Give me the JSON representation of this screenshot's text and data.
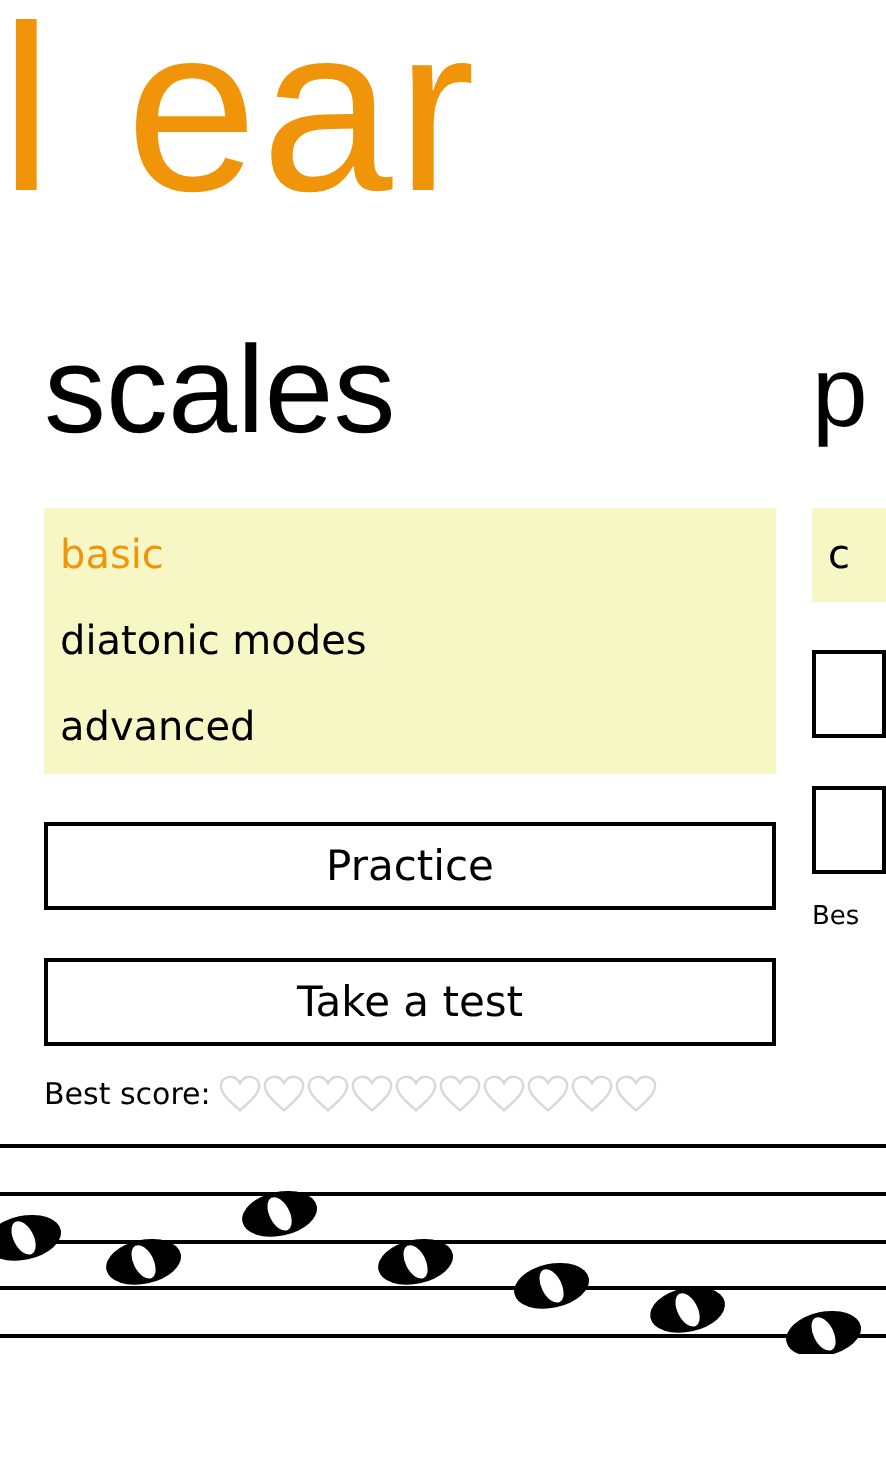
{
  "title": "l ear",
  "sections": [
    {
      "heading": "scales",
      "list": [
        {
          "label": "basic",
          "selected": true
        },
        {
          "label": "diatonic modes",
          "selected": false
        },
        {
          "label": "advanced",
          "selected": false
        }
      ],
      "buttons": [
        "Practice",
        "Take a test"
      ],
      "best_score_label": "Best score:",
      "stars": 0
    },
    {
      "heading": "p",
      "list": [
        {
          "label": "c",
          "selected": false
        }
      ],
      "best_score_label": "Bes"
    }
  ]
}
